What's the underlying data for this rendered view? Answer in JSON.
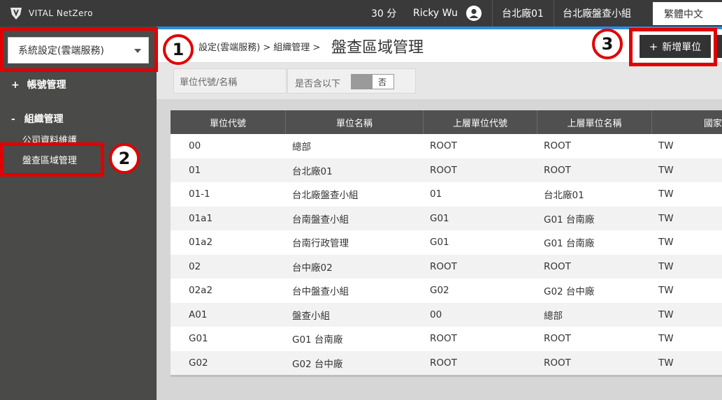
{
  "header": {
    "logo_text": "VITAL NetZero",
    "minutes": "30 分",
    "user_name": "Ricky Wu",
    "factory": "台北廠01",
    "team": "台北廠盤查小組",
    "language": "繁體中文"
  },
  "sidebar": {
    "select_value": "系統設定(雲端服務)",
    "sections": [
      {
        "prefix": "+",
        "label": "帳號管理"
      },
      {
        "prefix": "-",
        "label": "組織管理"
      }
    ],
    "sub_items": [
      "公司資料維護",
      "盤查區域管理"
    ]
  },
  "breadcrumb": {
    "path": "設定(雲端服務) > 組織管理 >",
    "title": "盤查區域管理"
  },
  "toolbar": {
    "add_label": "新增單位",
    "add_icon": "plus-icon"
  },
  "filters": {
    "search_placeholder": "單位代號/名稱",
    "include_below_label": "是否含以下",
    "include_below_value": "否"
  },
  "table": {
    "columns": [
      "單位代號",
      "單位名稱",
      "上層單位代號",
      "上層單位名稱",
      "國家代碼"
    ],
    "rows": [
      [
        "00",
        "總部",
        "ROOT",
        "ROOT",
        "TW"
      ],
      [
        "01",
        "台北廠01",
        "ROOT",
        "ROOT",
        "TW"
      ],
      [
        "01-1",
        "台北廠盤查小組",
        "01",
        "台北廠01",
        "TW"
      ],
      [
        "01a1",
        "台南盤查小組",
        "G01",
        "G01 台南廠",
        "TW"
      ],
      [
        "01a2",
        "台南行政管理",
        "G01",
        "G01 台南廠",
        "TW"
      ],
      [
        "02",
        "台中廠02",
        "ROOT",
        "ROOT",
        "TW"
      ],
      [
        "02a2",
        "台中盤查小組",
        "G02",
        "G02 台中廠",
        "TW"
      ],
      [
        "A01",
        "盤查小組",
        "00",
        "總部",
        "TW"
      ],
      [
        "G01",
        "G01 台南廠",
        "ROOT",
        "ROOT",
        "TW"
      ],
      [
        "G02",
        "G02 台中廠",
        "ROOT",
        "ROOT",
        "TW"
      ]
    ]
  },
  "callouts": [
    "1",
    "2",
    "3"
  ],
  "colors": {
    "topbar": "#3a3a3a",
    "sidebar": "#4a4a48",
    "accent": "#2f8de0",
    "callout_red": "#e00000",
    "table_header": "#505050"
  }
}
